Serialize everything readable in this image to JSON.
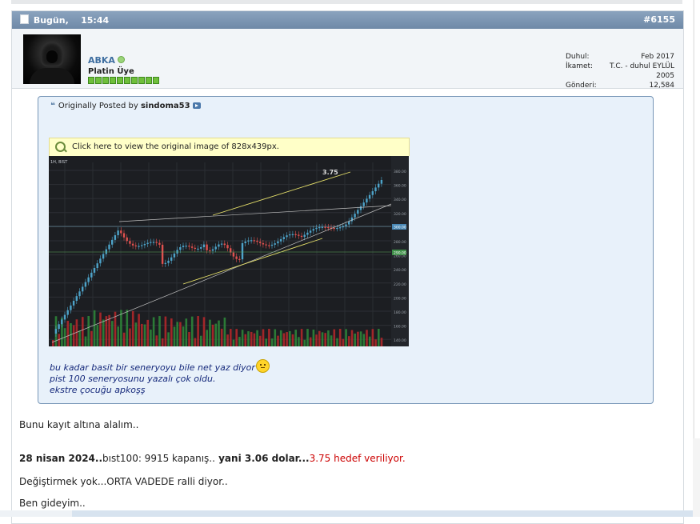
{
  "post": {
    "date": "Bugün,",
    "time": "15:44",
    "number": "#6155"
  },
  "user": {
    "name": "ABKA",
    "title": "Platin Üye",
    "rep_blocks": 10,
    "info": [
      {
        "label": "Duhul:",
        "value": "Feb 2017"
      },
      {
        "label": "İkamet:",
        "value": "T.C. - duhul EYLÜL 2005"
      },
      {
        "label": "Gönderi:",
        "value": "12,584"
      }
    ]
  },
  "quote": {
    "prefix": "Originally Posted by",
    "author": "sindoma53",
    "image_notice": "Click here to view the original image of 828x439px.",
    "lines": [
      "bu kadar basit bir seneryoyu bile net yaz diyor",
      "pist 100 seneryosunu yazalı çok oldu.",
      "ekstre çocuğu apkoşş"
    ]
  },
  "chart_data": {
    "type": "candlestick",
    "annotation": "3.75",
    "header": "1H, BIST",
    "y_ticks": [
      "380.00",
      "360.00",
      "340.00",
      "320.00",
      "300.00",
      "280.00",
      "260.00",
      "240.00",
      "220.00",
      "200.00",
      "180.00",
      "160.00",
      "140.00"
    ],
    "price_labels": [
      "300.00",
      "290.00"
    ],
    "colors": {
      "up": "#4da3c9",
      "down": "#e0514f",
      "volume_up": "#2e8b3a",
      "volume_down": "#b8282a",
      "trend": "#e6e06a",
      "line": "#c9c9c9"
    }
  },
  "message": {
    "line1": "Bunu kayıt altına alalım..",
    "line2_bold1": "28 nisan 2024..",
    "line2_normal1": "bıst100: 9915 kapanış..",
    "line2_bold2": " yani 3.06 dolar...",
    "line2_red": "3.75 hedef veriliyor.",
    "line3": "Değiştirmek yok...ORTA VADEDE ralli diyor..",
    "line4": "Ben gideyim.."
  }
}
